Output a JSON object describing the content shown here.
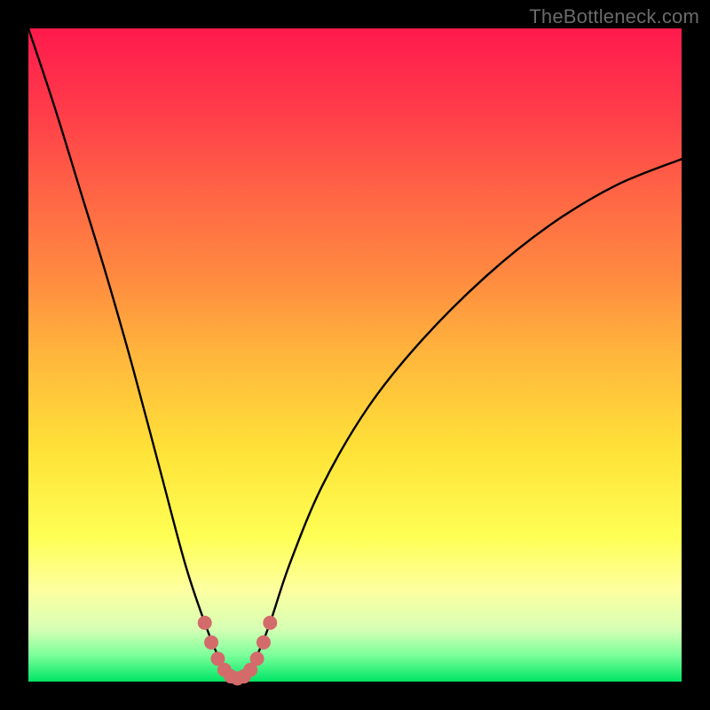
{
  "watermark": "TheBottleneck.com",
  "colors": {
    "curve_stroke": "#000000",
    "dot_fill": "#d36b6b"
  },
  "chart_data": {
    "type": "line",
    "title": "",
    "xlabel": "",
    "ylabel": "",
    "xlim": [
      0,
      100
    ],
    "ylim": [
      0,
      100
    ],
    "grid": false,
    "legend": false,
    "series": [
      {
        "name": "bottleneck-curve",
        "x": [
          0,
          4,
          8,
          12,
          16,
          20,
          24,
          27,
          29,
          30.5,
          32,
          33.5,
          35,
          37,
          40,
          45,
          52,
          60,
          70,
          80,
          90,
          100
        ],
        "y": [
          100,
          88,
          75,
          62,
          48,
          33,
          18,
          9,
          4,
          1.5,
          0.5,
          1.5,
          4,
          9,
          18,
          30,
          42,
          52,
          62,
          70,
          76,
          80
        ]
      }
    ],
    "highlight_dots": {
      "name": "trough-dots",
      "x": [
        27.0,
        28.0,
        29.0,
        30.0,
        31.0,
        32.0,
        33.0,
        34.0,
        35.0,
        36.0,
        37.0
      ],
      "y": [
        9.0,
        6.0,
        3.5,
        1.8,
        0.8,
        0.5,
        0.8,
        1.8,
        3.5,
        6.0,
        9.0
      ]
    }
  }
}
